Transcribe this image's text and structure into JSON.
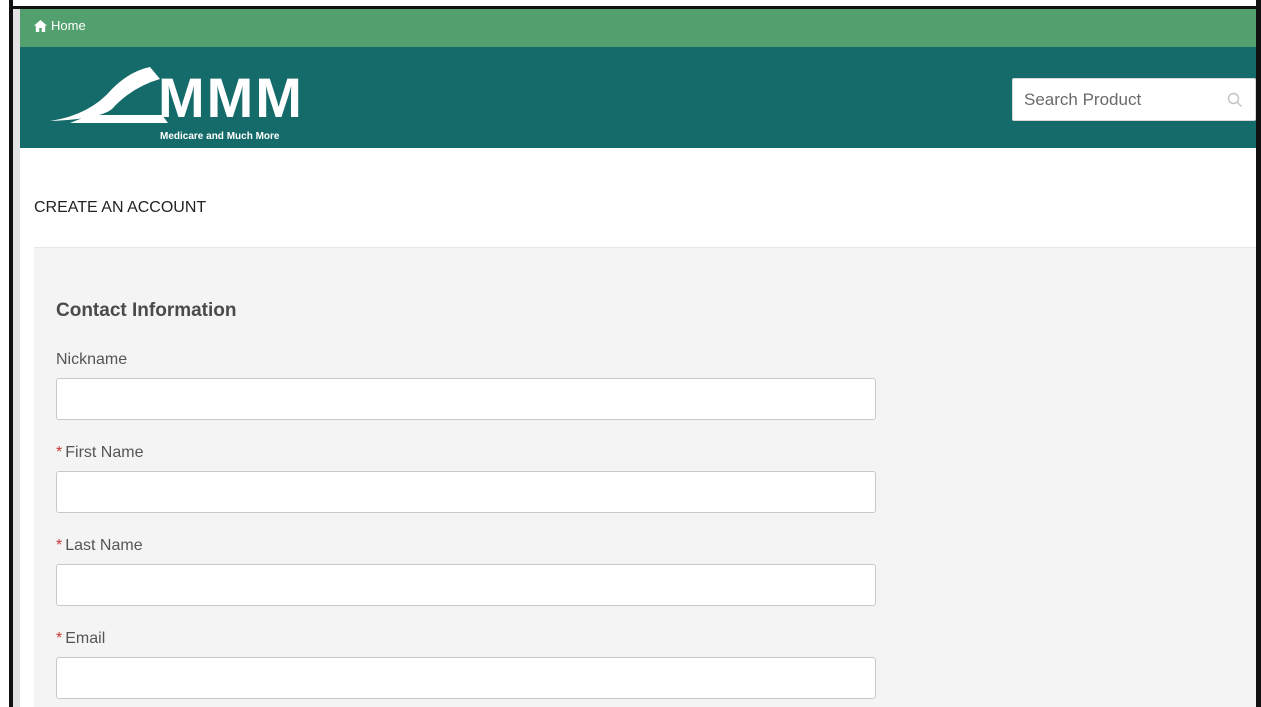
{
  "topbar": {
    "home_label": "Home"
  },
  "header": {
    "logo_text": "MMM",
    "logo_tagline": "Medicare and Much More",
    "search_placeholder": "Search Product"
  },
  "page": {
    "title": "CREATE AN ACCOUNT"
  },
  "form": {
    "section_title": "Contact Information",
    "required_marker": "*",
    "fields": [
      {
        "label": "Nickname",
        "required": false,
        "value": ""
      },
      {
        "label": "First Name",
        "required": true,
        "value": ""
      },
      {
        "label": "Last Name",
        "required": true,
        "value": ""
      },
      {
        "label": "Email",
        "required": true,
        "value": ""
      }
    ]
  },
  "colors": {
    "topbar": "#52a06d",
    "header": "#146b6a",
    "required": "#c23934"
  },
  "icons": {
    "home": "home-icon",
    "search": "search-icon"
  }
}
